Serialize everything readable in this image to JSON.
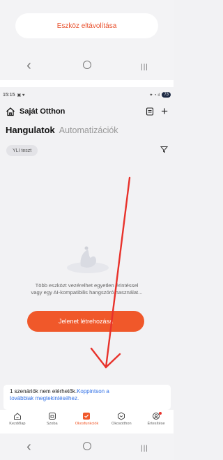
{
  "top": {
    "remove_button": "Eszköz eltávolítása"
  },
  "status": {
    "time": "15:15",
    "battery": "73"
  },
  "header": {
    "title": "Saját Otthon"
  },
  "tabs": {
    "active": "Hangulatok",
    "inactive": "Automatizációk"
  },
  "filter_chip": "YLI teszt",
  "empty_state": {
    "text_line1": "Több eszközt vezérelhet egyetlen érintéssel",
    "text_line2": "vagy egy AI-kompatibilis hangszóró használat..."
  },
  "cta": {
    "label": "Jelenet létrehozása"
  },
  "notice": {
    "text": "1 szenáriók nem elérhetők.",
    "link1": "Koppintson a",
    "link2": "továbbiak megtekintéséhez."
  },
  "bottom_nav": {
    "items": [
      {
        "label": "Kezdőlap",
        "icon": "home-icon"
      },
      {
        "label": "Szoba",
        "icon": "room-icon"
      },
      {
        "label": "Okosfunkciók",
        "icon": "smart-check-icon"
      },
      {
        "label": "Okosotthon",
        "icon": "hexagon-icon"
      },
      {
        "label": "Értesítése",
        "icon": "notification-icon"
      }
    ]
  },
  "colors": {
    "accent": "#f0582a",
    "link": "#2f6fe6",
    "arrow": "#e8322b"
  }
}
